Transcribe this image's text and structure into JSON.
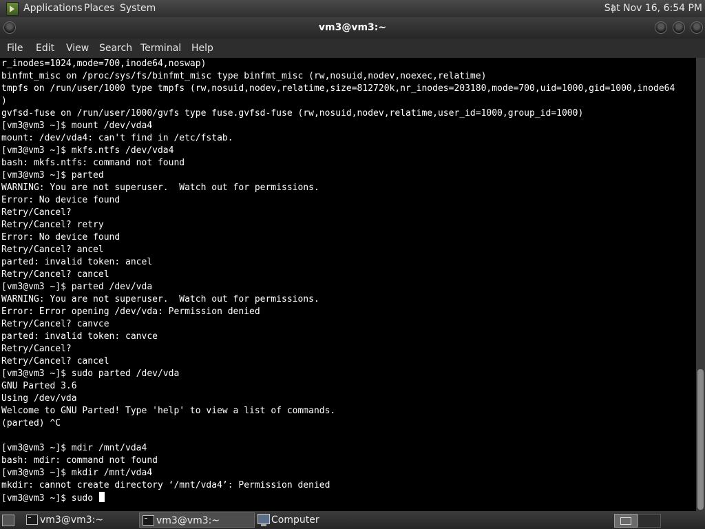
{
  "top_panel": {
    "menus": [
      "Applications",
      "Places",
      "System"
    ],
    "clock": "Sat Nov 16,  6:54 PM"
  },
  "window": {
    "title": "vm3@vm3:~"
  },
  "menubar": {
    "items": [
      "File",
      "Edit",
      "View",
      "Search",
      "Terminal",
      "Help"
    ]
  },
  "terminal": {
    "lines": [
      "r_inodes=1024,mode=700,inode64,noswap)",
      "binfmt_misc on /proc/sys/fs/binfmt_misc type binfmt_misc (rw,nosuid,nodev,noexec,relatime)",
      "tmpfs on /run/user/1000 type tmpfs (rw,nosuid,nodev,relatime,size=812720k,nr_inodes=203180,mode=700,uid=1000,gid=1000,inode64",
      ")",
      "gvfsd-fuse on /run/user/1000/gvfs type fuse.gvfsd-fuse (rw,nosuid,nodev,relatime,user_id=1000,group_id=1000)",
      "[vm3@vm3 ~]$ mount /dev/vda4",
      "mount: /dev/vda4: can't find in /etc/fstab.",
      "[vm3@vm3 ~]$ mkfs.ntfs /dev/vda4",
      "bash: mkfs.ntfs: command not found",
      "[vm3@vm3 ~]$ parted",
      "WARNING: You are not superuser.  Watch out for permissions.",
      "Error: No device found",
      "Retry/Cancel?",
      "Retry/Cancel? retry",
      "Error: No device found",
      "Retry/Cancel? ancel",
      "parted: invalid token: ancel",
      "Retry/Cancel? cancel",
      "[vm3@vm3 ~]$ parted /dev/vda",
      "WARNING: You are not superuser.  Watch out for permissions.",
      "Error: Error opening /dev/vda: Permission denied",
      "Retry/Cancel? canvce",
      "parted: invalid token: canvce",
      "Retry/Cancel?",
      "Retry/Cancel? cancel",
      "[vm3@vm3 ~]$ sudo parted /dev/vda",
      "GNU Parted 3.6",
      "Using /dev/vda",
      "Welcome to GNU Parted! Type 'help' to view a list of commands.",
      "(parted) ^C",
      "",
      "[vm3@vm3 ~]$ mdir /mnt/vda4",
      "bash: mdir: command not found",
      "[vm3@vm3 ~]$ mkdir /mnt/vda4",
      "mkdir: cannot create directory ‘/mnt/vda4’: Permission denied"
    ],
    "current_input": "[vm3@vm3 ~]$ sudo "
  },
  "taskbar": {
    "tasks": [
      "vm3@vm3:~",
      "vm3@vm3:~",
      "Computer"
    ]
  }
}
